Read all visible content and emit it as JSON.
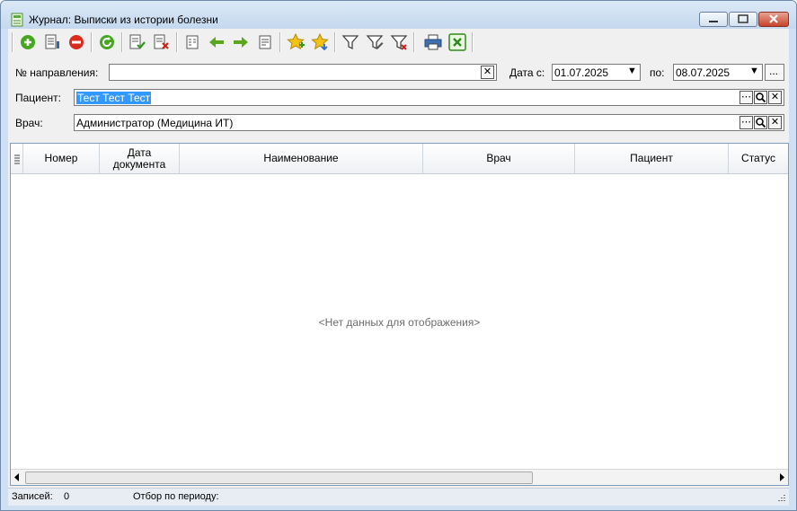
{
  "window": {
    "title": "Журнал: Выписки из истории болезни"
  },
  "toolbar": {
    "buttons": [
      "add-icon",
      "edit-document-icon",
      "delete-icon",
      "refresh-icon",
      "check-document-icon",
      "cancel-document-icon",
      "document-list-icon",
      "arrow-left-icon",
      "arrow-right-icon",
      "document-export-icon",
      "star-add-icon",
      "star-down-icon",
      "filter-icon",
      "filter-edit-icon",
      "filter-clear-icon",
      "print-icon",
      "excel-icon"
    ]
  },
  "filters": {
    "direction_label": "№ направления:",
    "direction_value": "",
    "date_from_label": "Дата с:",
    "date_from_value": "01.07.2025",
    "date_to_label": "по:",
    "date_to_value": "08.07.2025",
    "period_button": "...",
    "patient_label": "Пациент:",
    "patient_value": "Тест Тест Тест",
    "doctor_label": "Врач:",
    "doctor_value": "Администратор (Медицина ИТ)"
  },
  "grid": {
    "columns": [
      "Номер",
      "Дата документа",
      "Наименование",
      "Врач",
      "Пациент",
      "Статус"
    ],
    "empty_text": "<Нет данных для отображения>"
  },
  "status": {
    "records_label": "Записей:",
    "records_value": "0",
    "period_label": "Отбор по периоду:"
  },
  "colors": {
    "title_bg": "#c4d8ee",
    "accent_green": "#4caf20",
    "selection": "#3399ff"
  }
}
